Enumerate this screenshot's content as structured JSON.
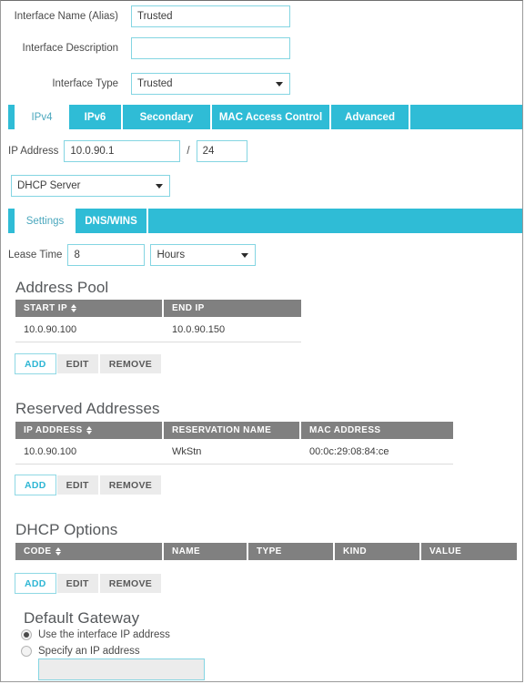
{
  "theme": {
    "accent": "#2fbcd6",
    "accent_border": "#84d5e2",
    "header_gray": "#808080",
    "button_gray": "#ebebeb"
  },
  "form": {
    "fields": [
      {
        "label": "Interface Name (Alias)",
        "value": "Trusted",
        "placeholder": ""
      },
      {
        "label": "Interface Description",
        "value": "",
        "placeholder": ""
      },
      {
        "label": "Interface Type",
        "value": "Trusted",
        "type": "select"
      }
    ]
  },
  "interface_tabs": {
    "items": [
      {
        "label": "IPv4",
        "active": true
      },
      {
        "label": "IPv6",
        "active": false
      },
      {
        "label": "Secondary",
        "active": false
      },
      {
        "label": "MAC Access Control",
        "active": false
      },
      {
        "label": "Advanced",
        "active": false
      }
    ]
  },
  "ipv4": {
    "ip_address_label": "IP Address",
    "ip_address": "10.0.90.1",
    "slash": "/",
    "prefix": "24",
    "mode_select": "DHCP Server"
  },
  "dhcp_tabs": {
    "items": [
      {
        "label": "Settings",
        "active": true
      },
      {
        "label": "DNS/WINS",
        "active": false
      }
    ]
  },
  "lease": {
    "label": "Lease Time",
    "value": "8",
    "unit": "Hours"
  },
  "address_pool": {
    "title": "Address Pool",
    "columns": [
      "START IP",
      "END IP"
    ],
    "sort_column": "START IP",
    "rows": [
      [
        "10.0.90.100",
        "10.0.90.150"
      ]
    ],
    "buttons": [
      "ADD",
      "EDIT",
      "REMOVE"
    ]
  },
  "reserved_addresses": {
    "title": "Reserved Addresses",
    "columns": [
      "IP ADDRESS",
      "RESERVATION NAME",
      "MAC ADDRESS"
    ],
    "sort_column": "IP ADDRESS",
    "rows": [
      [
        "10.0.90.100",
        "WkStn",
        "00:0c:29:08:84:ce"
      ]
    ],
    "buttons": [
      "ADD",
      "EDIT",
      "REMOVE"
    ]
  },
  "dhcp_options": {
    "title": "DHCP Options",
    "columns": [
      "CODE",
      "NAME",
      "TYPE",
      "KIND",
      "VALUE"
    ],
    "sort_column": "CODE",
    "rows": [],
    "buttons": [
      "ADD",
      "EDIT",
      "REMOVE"
    ]
  },
  "default_gateway": {
    "title": "Default Gateway",
    "options": [
      {
        "label": "Use the interface IP address",
        "selected": true
      },
      {
        "label": "Specify an IP address",
        "selected": false
      }
    ],
    "ip_value": "",
    "ip_disabled": true
  }
}
